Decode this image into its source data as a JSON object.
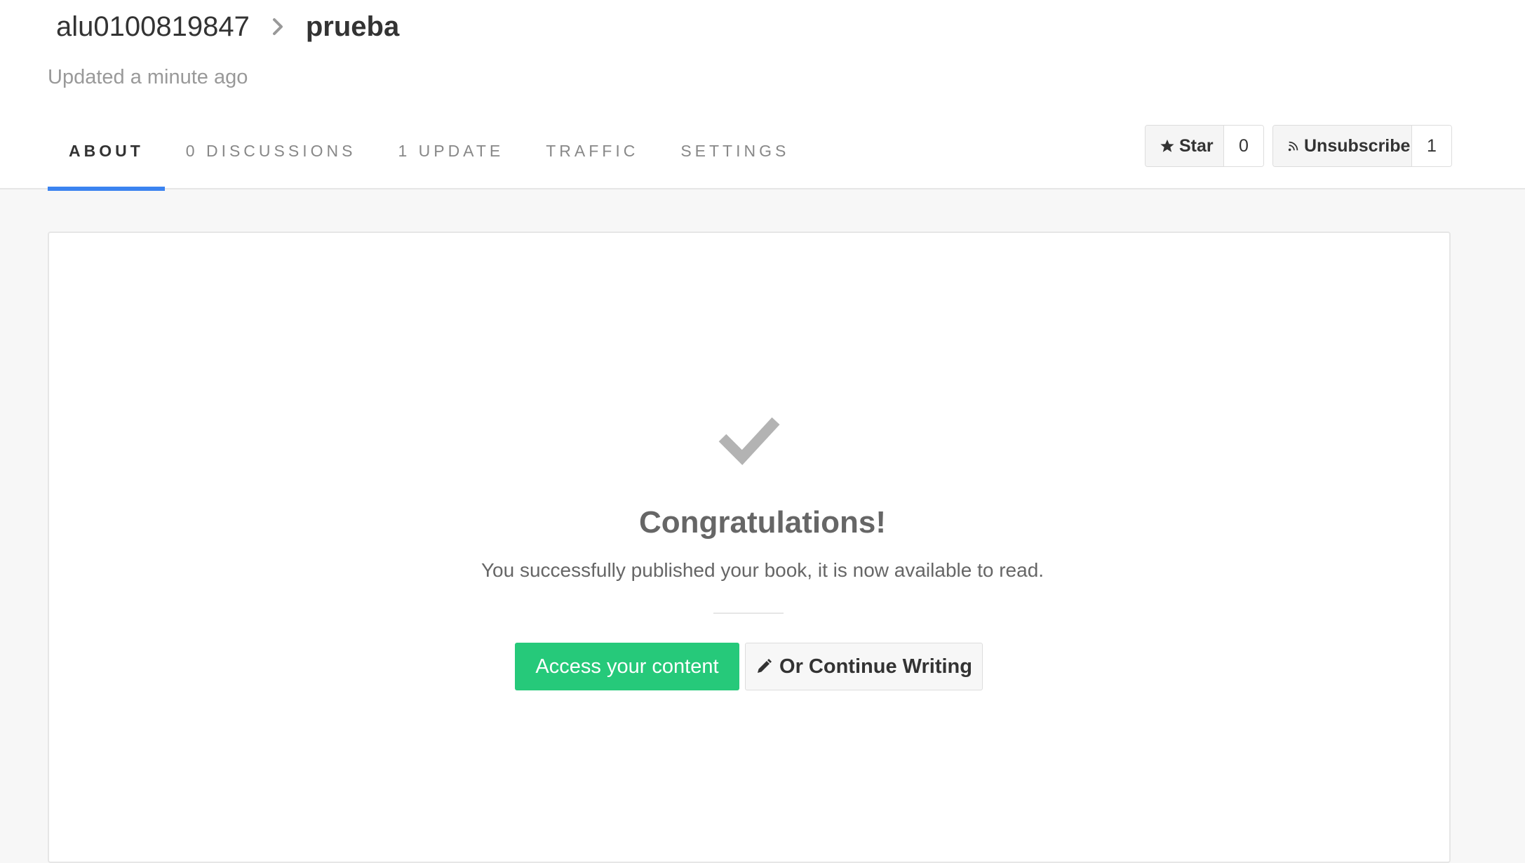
{
  "breadcrumb": {
    "user": "alu0100819847",
    "separator_icon": "chevron-right-icon",
    "book": "prueba"
  },
  "updated_text": "Updated a minute ago",
  "tabs": [
    {
      "label": "ABOUT",
      "active": true
    },
    {
      "label": "0 DISCUSSIONS",
      "active": false
    },
    {
      "label": "1 UPDATE",
      "active": false
    },
    {
      "label": "TRAFFIC",
      "active": false
    },
    {
      "label": "SETTINGS",
      "active": false
    }
  ],
  "actions": {
    "star": {
      "label": "Star",
      "count": "0",
      "icon": "star-icon"
    },
    "subscribe": {
      "label": "Unsubscribe",
      "count": "1",
      "icon": "rss-icon"
    }
  },
  "success": {
    "icon": "checkmark-icon",
    "title": "Congratulations!",
    "message": "You successfully published your book, it is now available to read.",
    "primary_button": "Access your content",
    "secondary_button": "Or Continue Writing",
    "secondary_icon": "pencil-icon"
  },
  "colors": {
    "active_tab_underline": "#3b83f0",
    "primary_button": "#26c97a",
    "checkmark": "#b3b3b3"
  }
}
